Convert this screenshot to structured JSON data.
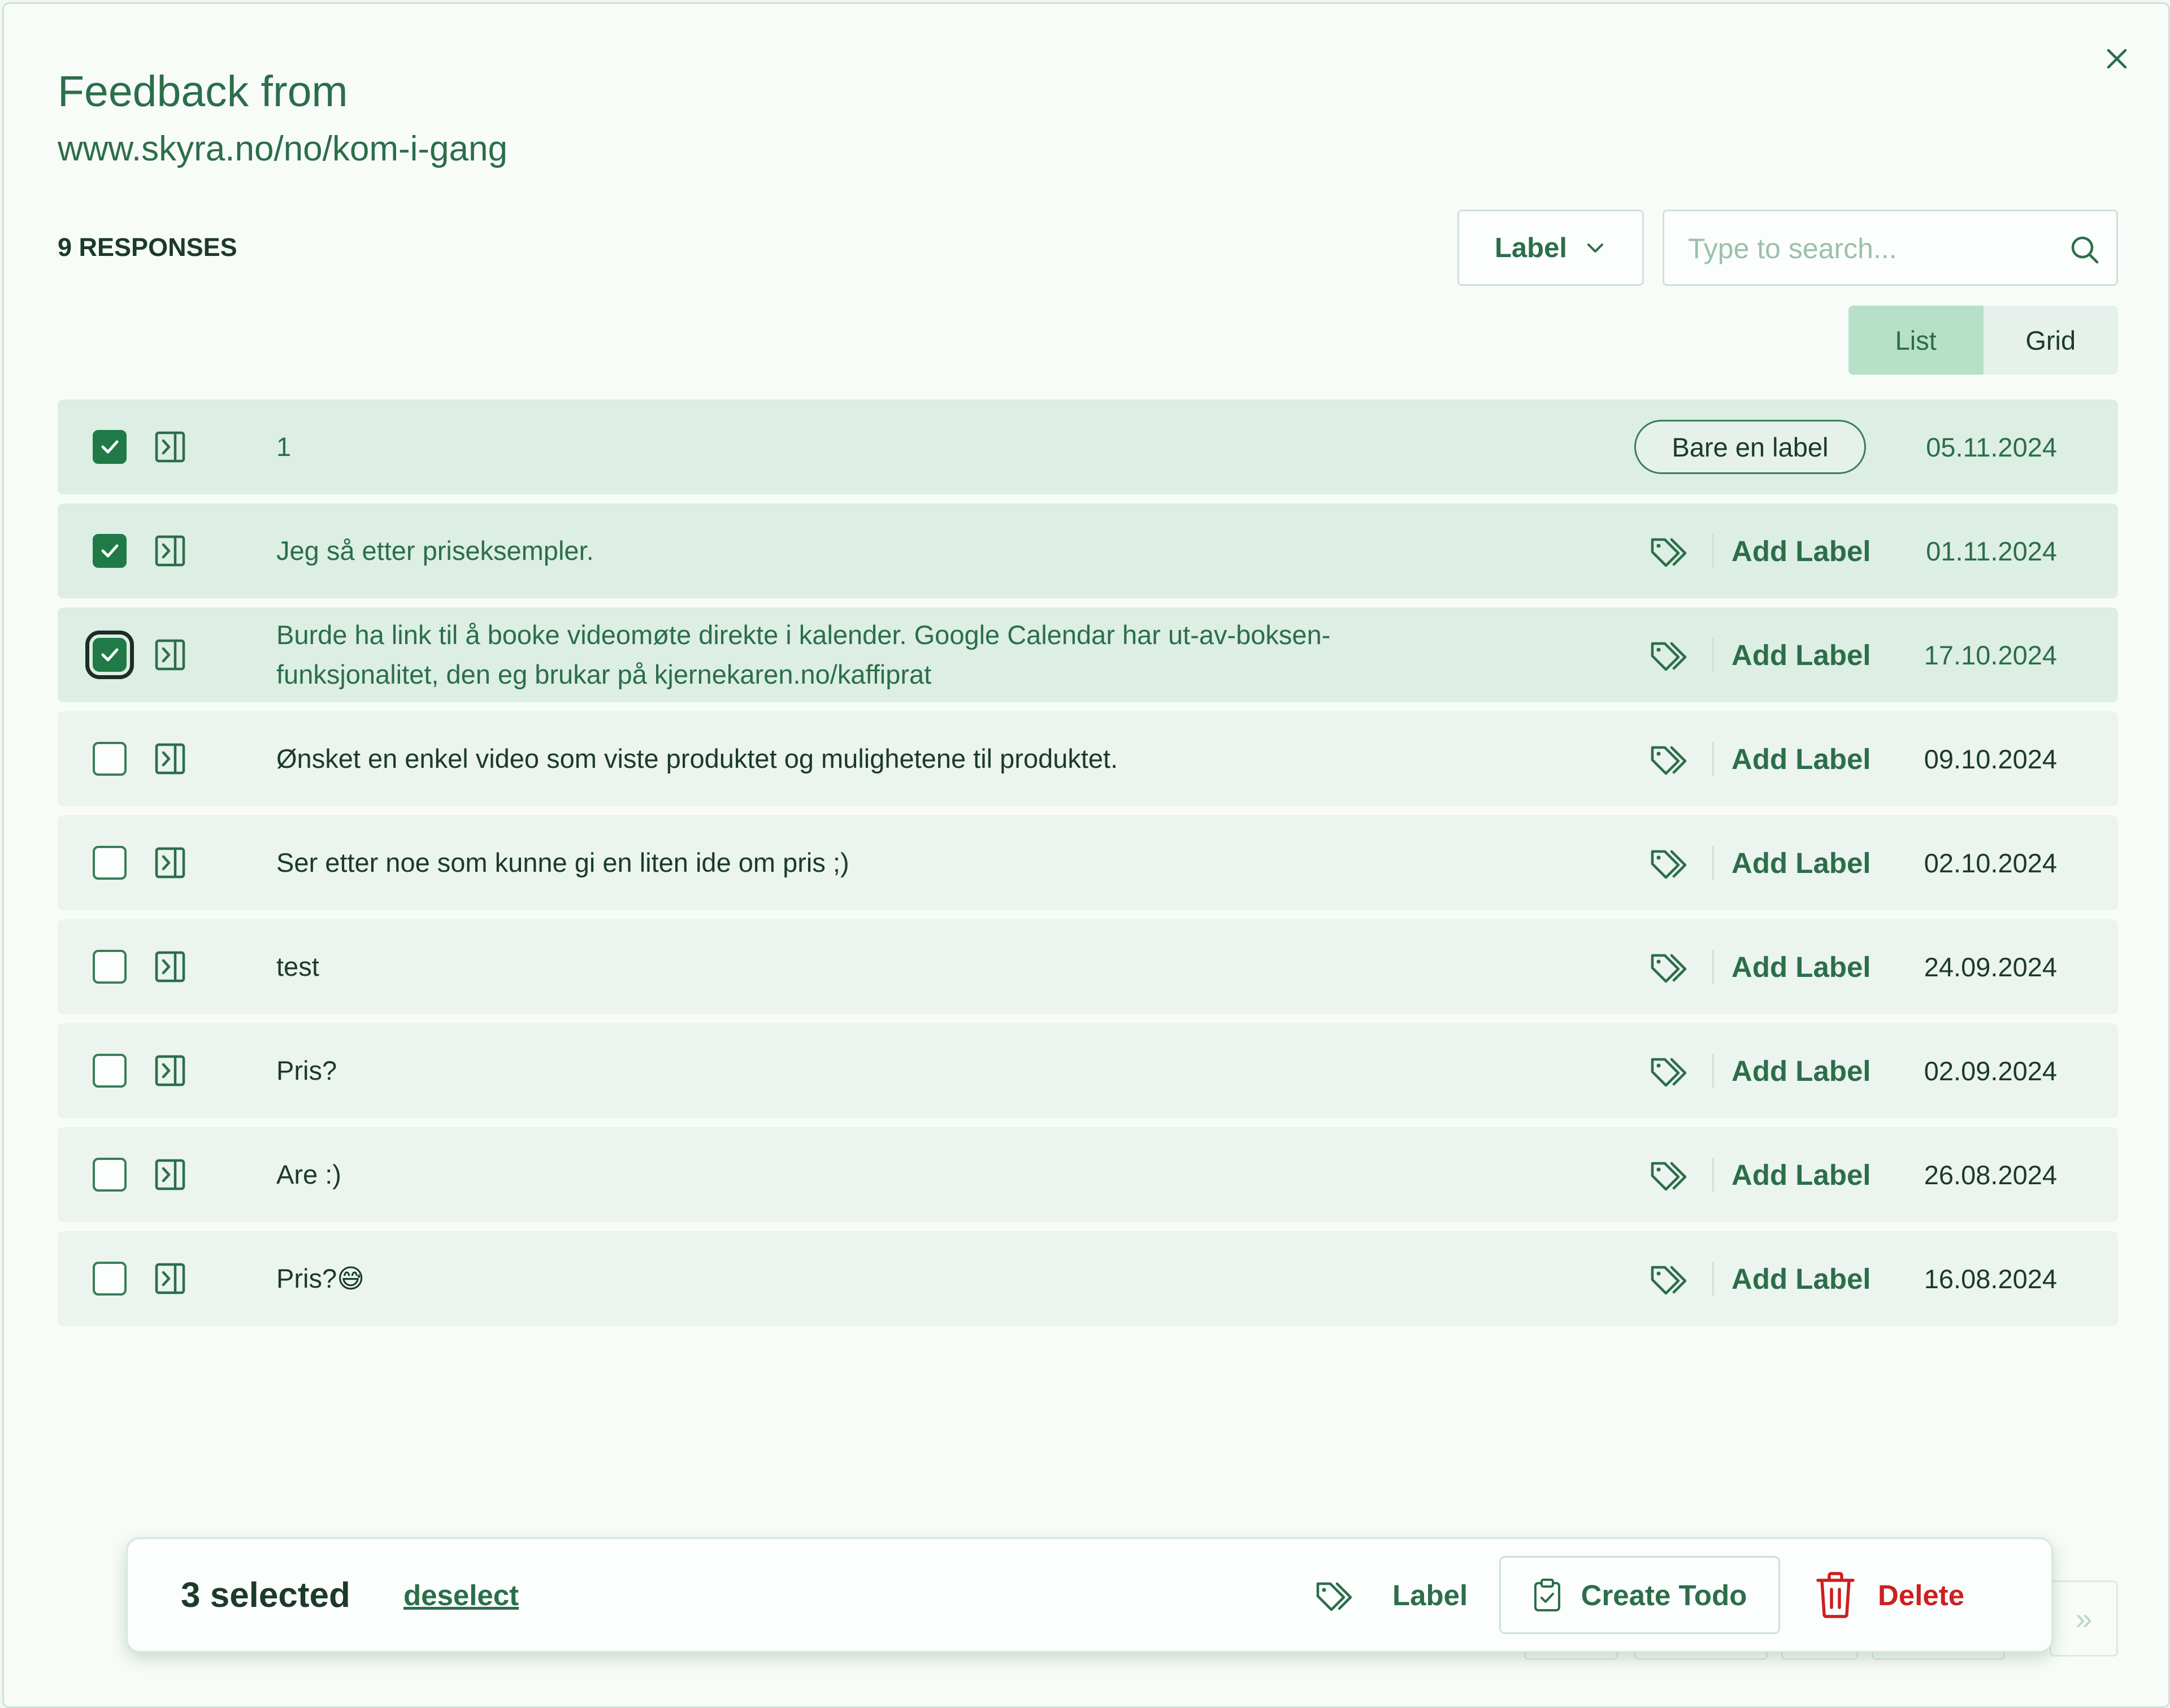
{
  "dialog": {
    "title": "Feedback from",
    "subtitle": "www.skyra.no/no/kom-i-gang",
    "response_count": "9 RESPONSES"
  },
  "toolbar": {
    "label_filter": "Label",
    "search_placeholder": "Type to search...",
    "view_list": "List",
    "view_grid": "Grid",
    "active_view": "List"
  },
  "responses": [
    {
      "text": "1",
      "date": "05.11.2024",
      "checked": true,
      "label": "Bare en label"
    },
    {
      "text": "Jeg så etter priseksempler.",
      "date": "01.11.2024",
      "checked": true,
      "add_label": "Add Label"
    },
    {
      "text": "Burde ha link til å booke videomøte direkte i kalender. Google Calendar har ut-av-boksen-funksjonalitet, den eg brukar på kjernekaren.no/kaffiprat",
      "date": "17.10.2024",
      "checked": true,
      "add_label": "Add Label"
    },
    {
      "text": "Ønsket en enkel video som viste produktet og mulighetene til produktet.",
      "date": "09.10.2024",
      "checked": false,
      "add_label": "Add Label"
    },
    {
      "text": "Ser etter noe som kunne gi en liten ide om pris ;)",
      "date": "02.10.2024",
      "checked": false,
      "add_label": "Add Label"
    },
    {
      "text": "test",
      "date": "24.09.2024",
      "checked": false,
      "add_label": "Add Label"
    },
    {
      "text": "Pris?",
      "date": "02.09.2024",
      "checked": false,
      "add_label": "Add Label"
    },
    {
      "text": "Are :)",
      "date": "26.08.2024",
      "checked": false,
      "add_label": "Add Label"
    },
    {
      "text": "Pris?😅",
      "date": "16.08.2024",
      "checked": false,
      "add_label": "Add Label"
    }
  ],
  "action_bar": {
    "selected_count": "3 selected",
    "deselect": "deselect",
    "label": "Label",
    "create_todo": "Create Todo",
    "delete": "Delete"
  },
  "pagination": {
    "next": "»"
  },
  "colors": {
    "primary": "#2b6e4a",
    "checkbox": "#1f7a47",
    "danger": "#cc1f1f",
    "row_bg": "#ebf4ef",
    "row_selected_bg": "#ddeee4"
  }
}
